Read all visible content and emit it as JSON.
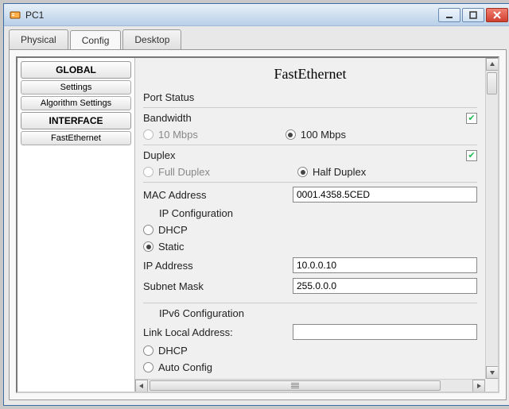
{
  "window": {
    "title": "PC1"
  },
  "tabs": {
    "physical": "Physical",
    "config": "Config",
    "desktop": "Desktop"
  },
  "sidebar": {
    "global_header": "GLOBAL",
    "settings": "Settings",
    "algorithm": "Algorithm Settings",
    "interface_header": "INTERFACE",
    "fastethernet": "FastEthernet"
  },
  "panel": {
    "title": "FastEthernet",
    "port_status_label": "Port Status",
    "bandwidth_label": "Bandwidth",
    "bandwidth_checked": true,
    "bw_10": "10 Mbps",
    "bw_100": "100 Mbps",
    "bw_selected": "100",
    "duplex_label": "Duplex",
    "duplex_checked": true,
    "dx_full": "Full Duplex",
    "dx_half": "Half Duplex",
    "dx_selected": "half",
    "mac_label": "MAC Address",
    "mac_value": "0001.4358.5CED",
    "ipconf_label": "IP Configuration",
    "dhcp_label": "DHCP",
    "static_label": "Static",
    "ip_mode": "static",
    "ip_address_label": "IP Address",
    "ip_address_value": "10.0.0.10",
    "subnet_label": "Subnet Mask",
    "subnet_value": "255.0.0.0",
    "ipv6conf_label": "IPv6 Configuration",
    "link_local_label": "Link Local Address:",
    "link_local_value": "",
    "ipv6_dhcp_label": "DHCP",
    "ipv6_auto_label": "Auto Config"
  }
}
